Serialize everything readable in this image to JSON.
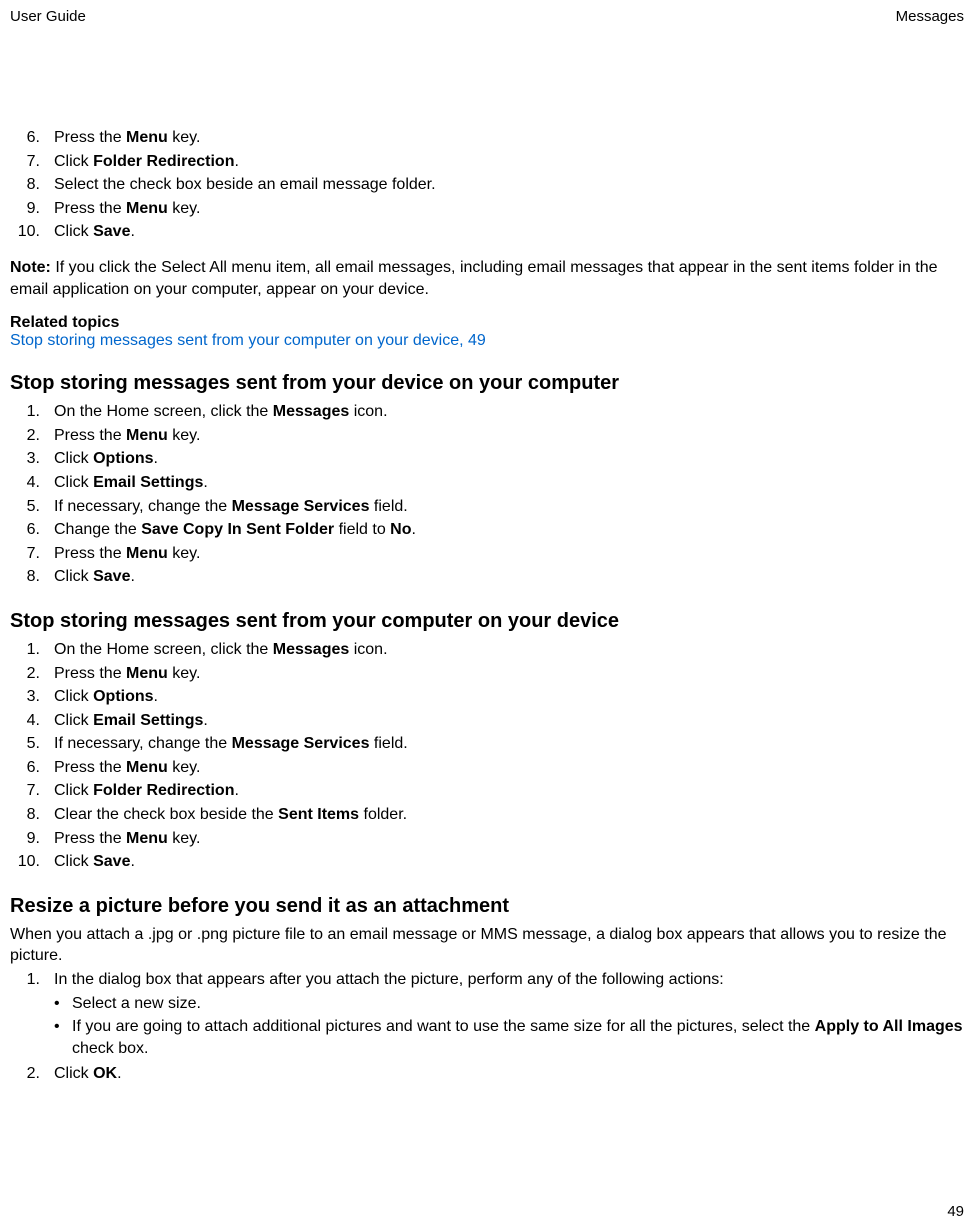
{
  "header": {
    "left": "User Guide",
    "right": "Messages"
  },
  "stepsA": [
    {
      "n": "6.",
      "pre": "Press the ",
      "b": "Menu",
      "post": " key."
    },
    {
      "n": "7.",
      "pre": "Click ",
      "b": "Folder Redirection",
      "post": "."
    },
    {
      "n": "8.",
      "pre": "Select the check box beside an email message folder.",
      "b": "",
      "post": ""
    },
    {
      "n": "9.",
      "pre": "Press the ",
      "b": "Menu",
      "post": " key."
    },
    {
      "n": "10.",
      "pre": "Click ",
      "b": "Save",
      "post": "."
    }
  ],
  "note": {
    "label": "Note:",
    "text": "  If you click the Select All menu item, all email messages, including email messages that appear in the sent items folder in the email application on your computer, appear on your device."
  },
  "related": {
    "heading": "Related topics",
    "link": "Stop storing messages sent from your computer on your device, 49"
  },
  "sectionB": {
    "title": "Stop storing messages sent from your device on your computer",
    "steps": [
      {
        "n": "1.",
        "pre": "On the Home screen, click the ",
        "b": "Messages",
        "post": " icon."
      },
      {
        "n": "2.",
        "pre": "Press the ",
        "b": "Menu",
        "post": " key."
      },
      {
        "n": "3.",
        "pre": "Click ",
        "b": "Options",
        "post": "."
      },
      {
        "n": "4.",
        "pre": "Click ",
        "b": "Email Settings",
        "post": "."
      },
      {
        "n": "5.",
        "pre": "If necessary, change the ",
        "b": "Message Services",
        "post": " field."
      },
      {
        "n": "6.",
        "pre": "Change the ",
        "b": "Save Copy In Sent Folder",
        "post": " field to ",
        "b2": "No",
        "post2": "."
      },
      {
        "n": "7.",
        "pre": "Press the ",
        "b": "Menu",
        "post": " key."
      },
      {
        "n": "8.",
        "pre": "Click ",
        "b": "Save",
        "post": "."
      }
    ]
  },
  "sectionC": {
    "title": "Stop storing messages sent from your computer on your device",
    "steps": [
      {
        "n": "1.",
        "pre": "On the Home screen, click the ",
        "b": "Messages",
        "post": " icon."
      },
      {
        "n": "2.",
        "pre": "Press the ",
        "b": "Menu",
        "post": " key."
      },
      {
        "n": "3.",
        "pre": "Click ",
        "b": "Options",
        "post": "."
      },
      {
        "n": "4.",
        "pre": "Click ",
        "b": "Email Settings",
        "post": "."
      },
      {
        "n": "5.",
        "pre": "If necessary, change the ",
        "b": "Message Services",
        "post": " field."
      },
      {
        "n": "6.",
        "pre": "Press the ",
        "b": "Menu",
        "post": " key."
      },
      {
        "n": "7.",
        "pre": "Click ",
        "b": "Folder Redirection",
        "post": "."
      },
      {
        "n": "8.",
        "pre": "Clear the check box beside the ",
        "b": "Sent Items",
        "post": " folder."
      },
      {
        "n": "9.",
        "pre": "Press the ",
        "b": "Menu",
        "post": " key."
      },
      {
        "n": "10.",
        "pre": "Click ",
        "b": "Save",
        "post": "."
      }
    ]
  },
  "sectionD": {
    "title": "Resize a picture before you send it as an attachment",
    "intro": "When you attach a .jpg or .png picture file to an email message or MMS message, a dialog box appears that allows you to resize the picture.",
    "step1": {
      "n": "1.",
      "text": "In the dialog box that appears after you attach the picture, perform any of the following actions:"
    },
    "bullets": [
      {
        "text": "Select a new size."
      },
      {
        "pre": "If you are going to attach additional pictures and want to use the same size for all the pictures, select the ",
        "b": "Apply to All Images",
        "post": " check box."
      }
    ],
    "step2": {
      "n": "2.",
      "pre": "Click ",
      "b": "OK",
      "post": "."
    }
  },
  "footer": {
    "page": "49"
  }
}
